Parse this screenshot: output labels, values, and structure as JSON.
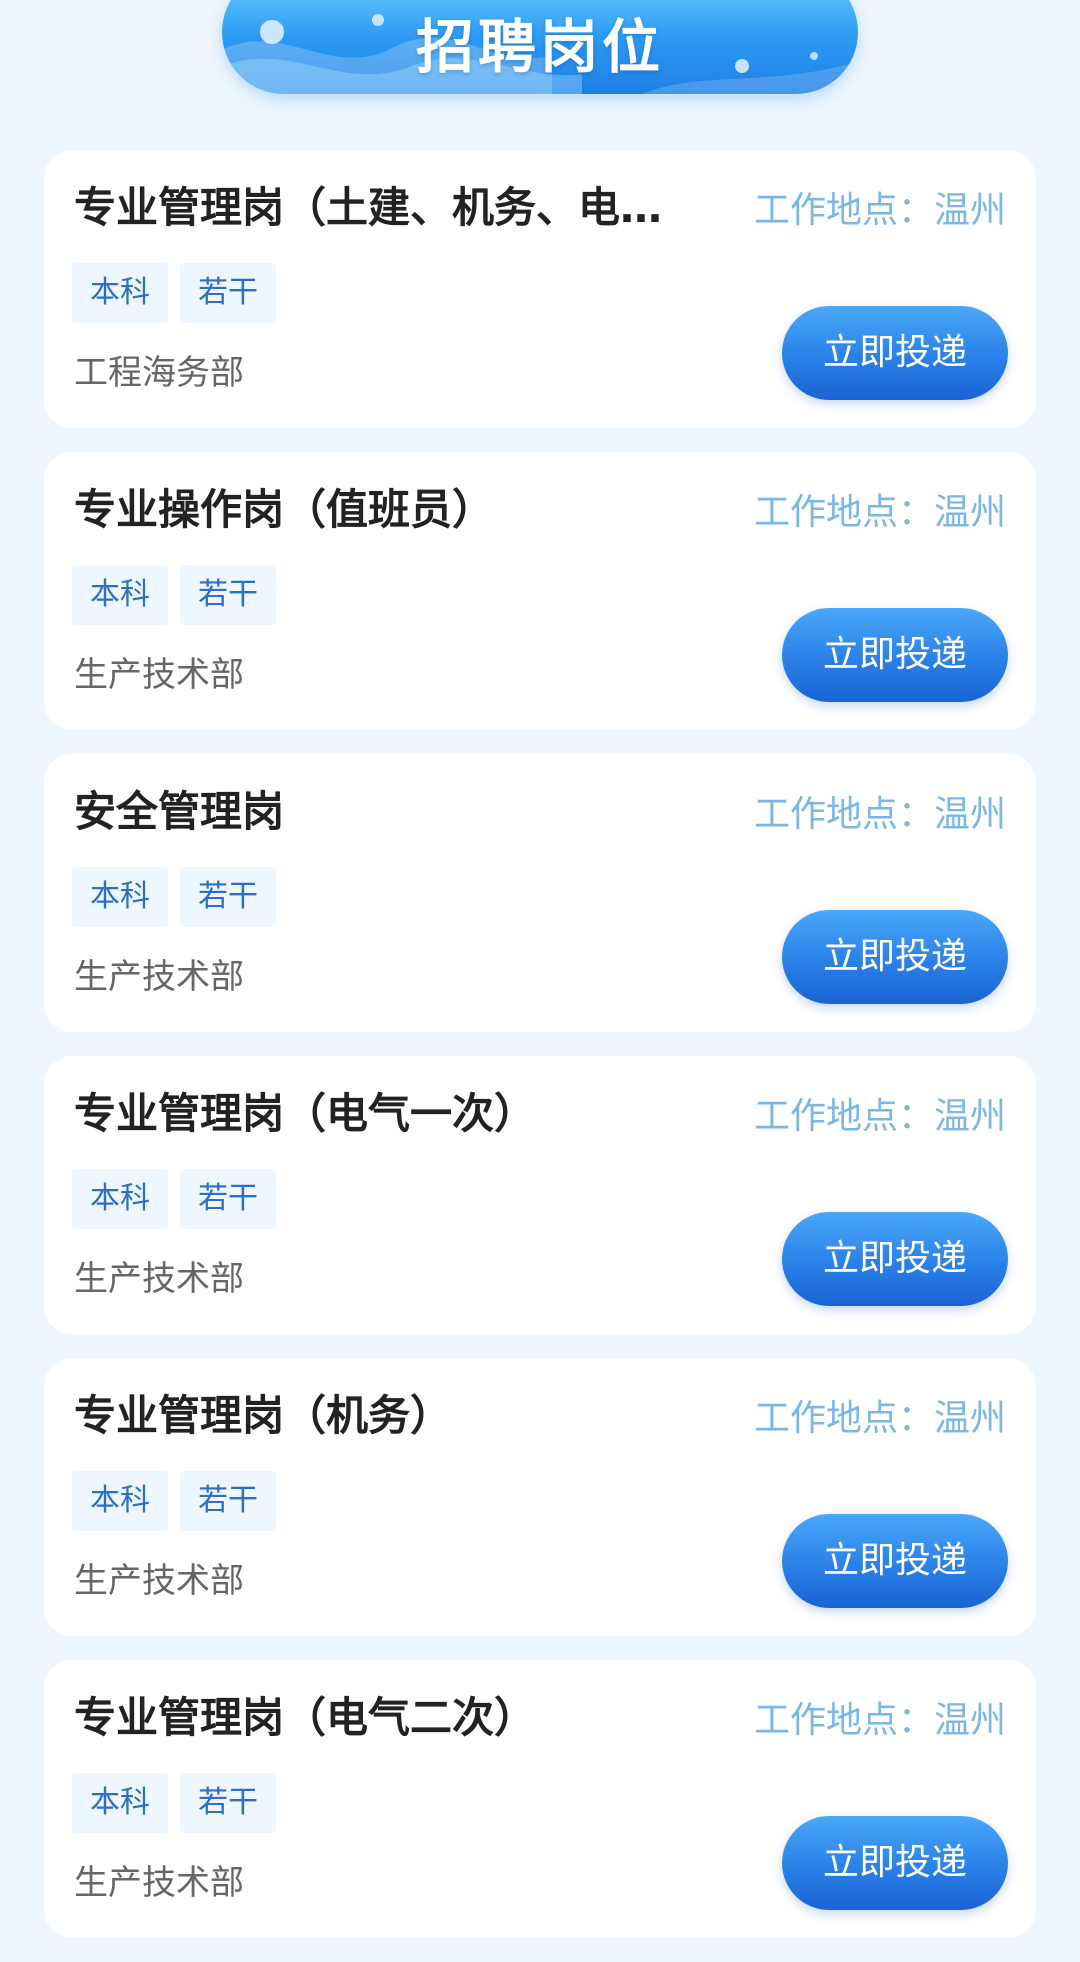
{
  "header": {
    "title": "招聘岗位"
  },
  "colors": {
    "background": "#eef6fe",
    "accent": "#2a80e8",
    "location_text": "#7ab6e6",
    "tag_text": "#2c6fc4"
  },
  "jobs": [
    {
      "title": "专业管理岗（土建、机务、电…",
      "location": "工作地点：温州",
      "tags": [
        "本科",
        "若干"
      ],
      "department": "工程海务部",
      "apply_label": "立即投递"
    },
    {
      "title": "专业操作岗（值班员）",
      "location": "工作地点：温州",
      "tags": [
        "本科",
        "若干"
      ],
      "department": "生产技术部",
      "apply_label": "立即投递"
    },
    {
      "title": "安全管理岗",
      "location": "工作地点：温州",
      "tags": [
        "本科",
        "若干"
      ],
      "department": "生产技术部",
      "apply_label": "立即投递"
    },
    {
      "title": "专业管理岗（电气一次）",
      "location": "工作地点：温州",
      "tags": [
        "本科",
        "若干"
      ],
      "department": "生产技术部",
      "apply_label": "立即投递"
    },
    {
      "title": "专业管理岗（机务）",
      "location": "工作地点：温州",
      "tags": [
        "本科",
        "若干"
      ],
      "department": "生产技术部",
      "apply_label": "立即投递"
    },
    {
      "title": "专业管理岗（电气二次）",
      "location": "工作地点：温州",
      "tags": [
        "本科",
        "若干"
      ],
      "department": "生产技术部",
      "apply_label": "立即投递"
    }
  ]
}
